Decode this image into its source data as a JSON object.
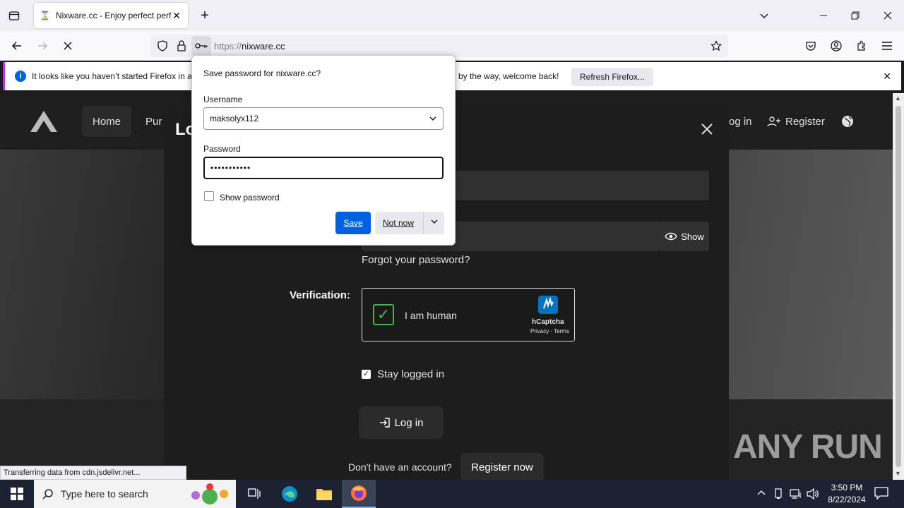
{
  "browser": {
    "tab_title": "Nixware.cc - Enjoy perfect perfo",
    "url_scheme": "https://",
    "url_host": "nixware.cc"
  },
  "notification": {
    "text": "It looks like you haven’t started Firefox in a",
    "text_tail": "by the way, welcome back!",
    "button": "Refresh Firefox..."
  },
  "site": {
    "nav_home": "Home",
    "nav_purchase": "Pur",
    "nav_login": "og in",
    "nav_register": "Register",
    "modal_title": "Lo",
    "show_label": "Show",
    "forgot": "Forgot your password?",
    "verification": "Verification:",
    "captcha_text": "I am human",
    "captcha_brand": "hCaptcha",
    "captcha_links": "Privacy - Terms",
    "stay_logged": "Stay logged in",
    "login_button": "Log in",
    "no_account": "Don't have an account?",
    "register_now": "Register now"
  },
  "popup": {
    "title": "Save password for nixware.cc?",
    "username_label": "Username",
    "username_value": "maksolyx112",
    "password_label": "Password",
    "password_value": "•••••••••••",
    "show_password": "Show password",
    "save": "Save",
    "not_now": "Not now"
  },
  "status_text": "Transferring data from cdn.jsdelivr.net...",
  "taskbar": {
    "search_placeholder": "Type here to search",
    "time": "3:50 PM",
    "date": "8/22/2024"
  },
  "watermark": "ANY RUN",
  "colors": {
    "accent_blue": "#0061e0",
    "notif_bar": "#b833e1",
    "captcha_check": "#4caf50"
  }
}
